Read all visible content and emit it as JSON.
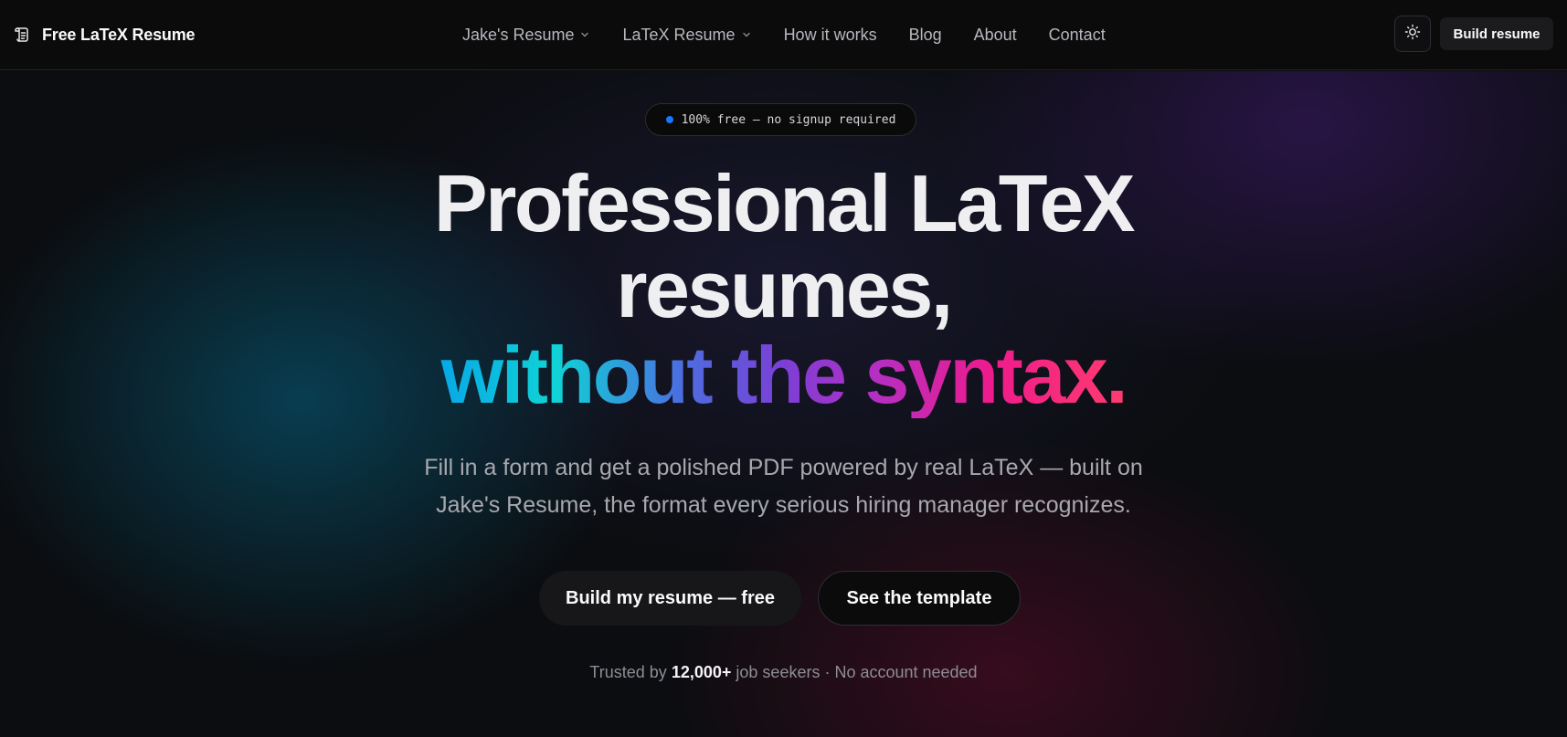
{
  "nav": {
    "brand": "Free LaTeX Resume",
    "links": [
      {
        "label": "Jake's Resume",
        "has_dropdown": true
      },
      {
        "label": "LaTeX Resume",
        "has_dropdown": true
      },
      {
        "label": "How it works",
        "has_dropdown": false
      },
      {
        "label": "Blog",
        "has_dropdown": false
      },
      {
        "label": "About",
        "has_dropdown": false
      },
      {
        "label": "Contact",
        "has_dropdown": false
      }
    ],
    "theme_toggle_icon": "sun-icon",
    "cta_label": "Build resume"
  },
  "hero": {
    "badge_text": "100% free — no signup required",
    "badge_dot_color": "#1677ff",
    "headline_line1": "Professional LaTeX",
    "headline_line2": "resumes,",
    "headline_accent": "without the syntax.",
    "subtext_line1": "Fill in a form and get a polished PDF powered by real LaTeX — built on",
    "subtext_line2": "Jake's Resume, the format every serious hiring manager recognizes.",
    "primary_cta": "Build my resume — free",
    "secondary_cta": "See the template",
    "trusted_prefix": "Trusted by",
    "trusted_count": "12,000+",
    "trusted_suffix": "job seekers · No account needed"
  },
  "colors": {
    "background": "#0a0a0b",
    "accent_gradient": [
      "#08a7e6",
      "#0fd3d6",
      "#7b3fd6",
      "#ee1b8c",
      "#ff3d6e"
    ]
  }
}
